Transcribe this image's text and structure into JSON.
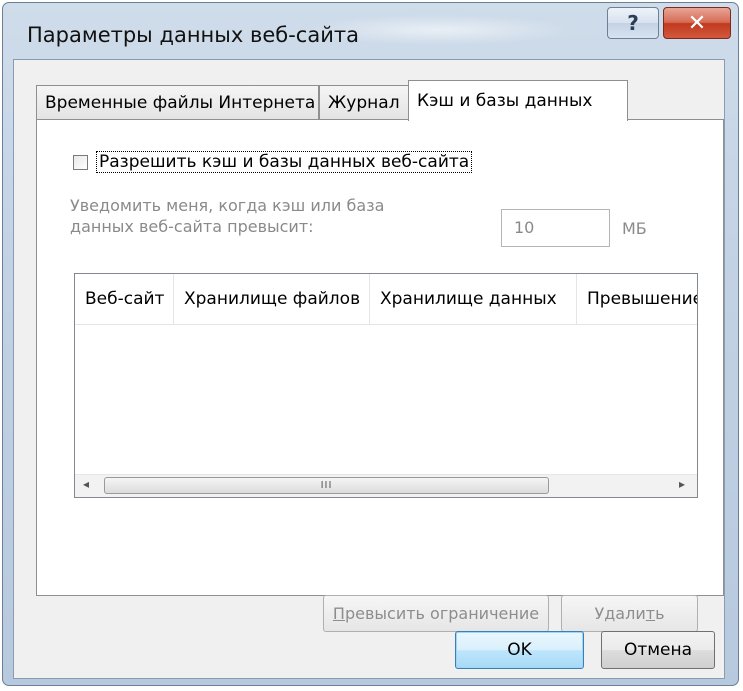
{
  "window": {
    "title": "Параметры данных веб-сайта",
    "help_glyph": "?",
    "close_glyph": "✕"
  },
  "tabs": [
    {
      "label": "Временные файлы Интернета",
      "active": false
    },
    {
      "label": "Журнал",
      "active": false
    },
    {
      "label": "Кэш и базы данных",
      "active": true
    }
  ],
  "cache": {
    "allow_label": "Разрешить кэш и базы данных веб-сайта",
    "allow_checked": false,
    "notify_line1": "Уведомить меня, когда кэш или база",
    "notify_line2": "данных веб-сайта превысит:",
    "limit_value": "10",
    "limit_unit": "МБ"
  },
  "table": {
    "columns": [
      "Веб-сайт",
      "Хранилище файлов",
      "Хранилище данных",
      "Превышение"
    ],
    "rows": [],
    "scroll_left": "◂",
    "scroll_right": "▸",
    "thumb_grip": "III"
  },
  "panel_buttons": {
    "exceed_pre": "",
    "exceed_hotkey": "П",
    "exceed_post": "ревысить ограничение",
    "delete_pre": "Удали",
    "delete_hotkey": "т",
    "delete_post": "ь"
  },
  "dialog_buttons": {
    "ok": "OK",
    "cancel": "Отмена"
  }
}
